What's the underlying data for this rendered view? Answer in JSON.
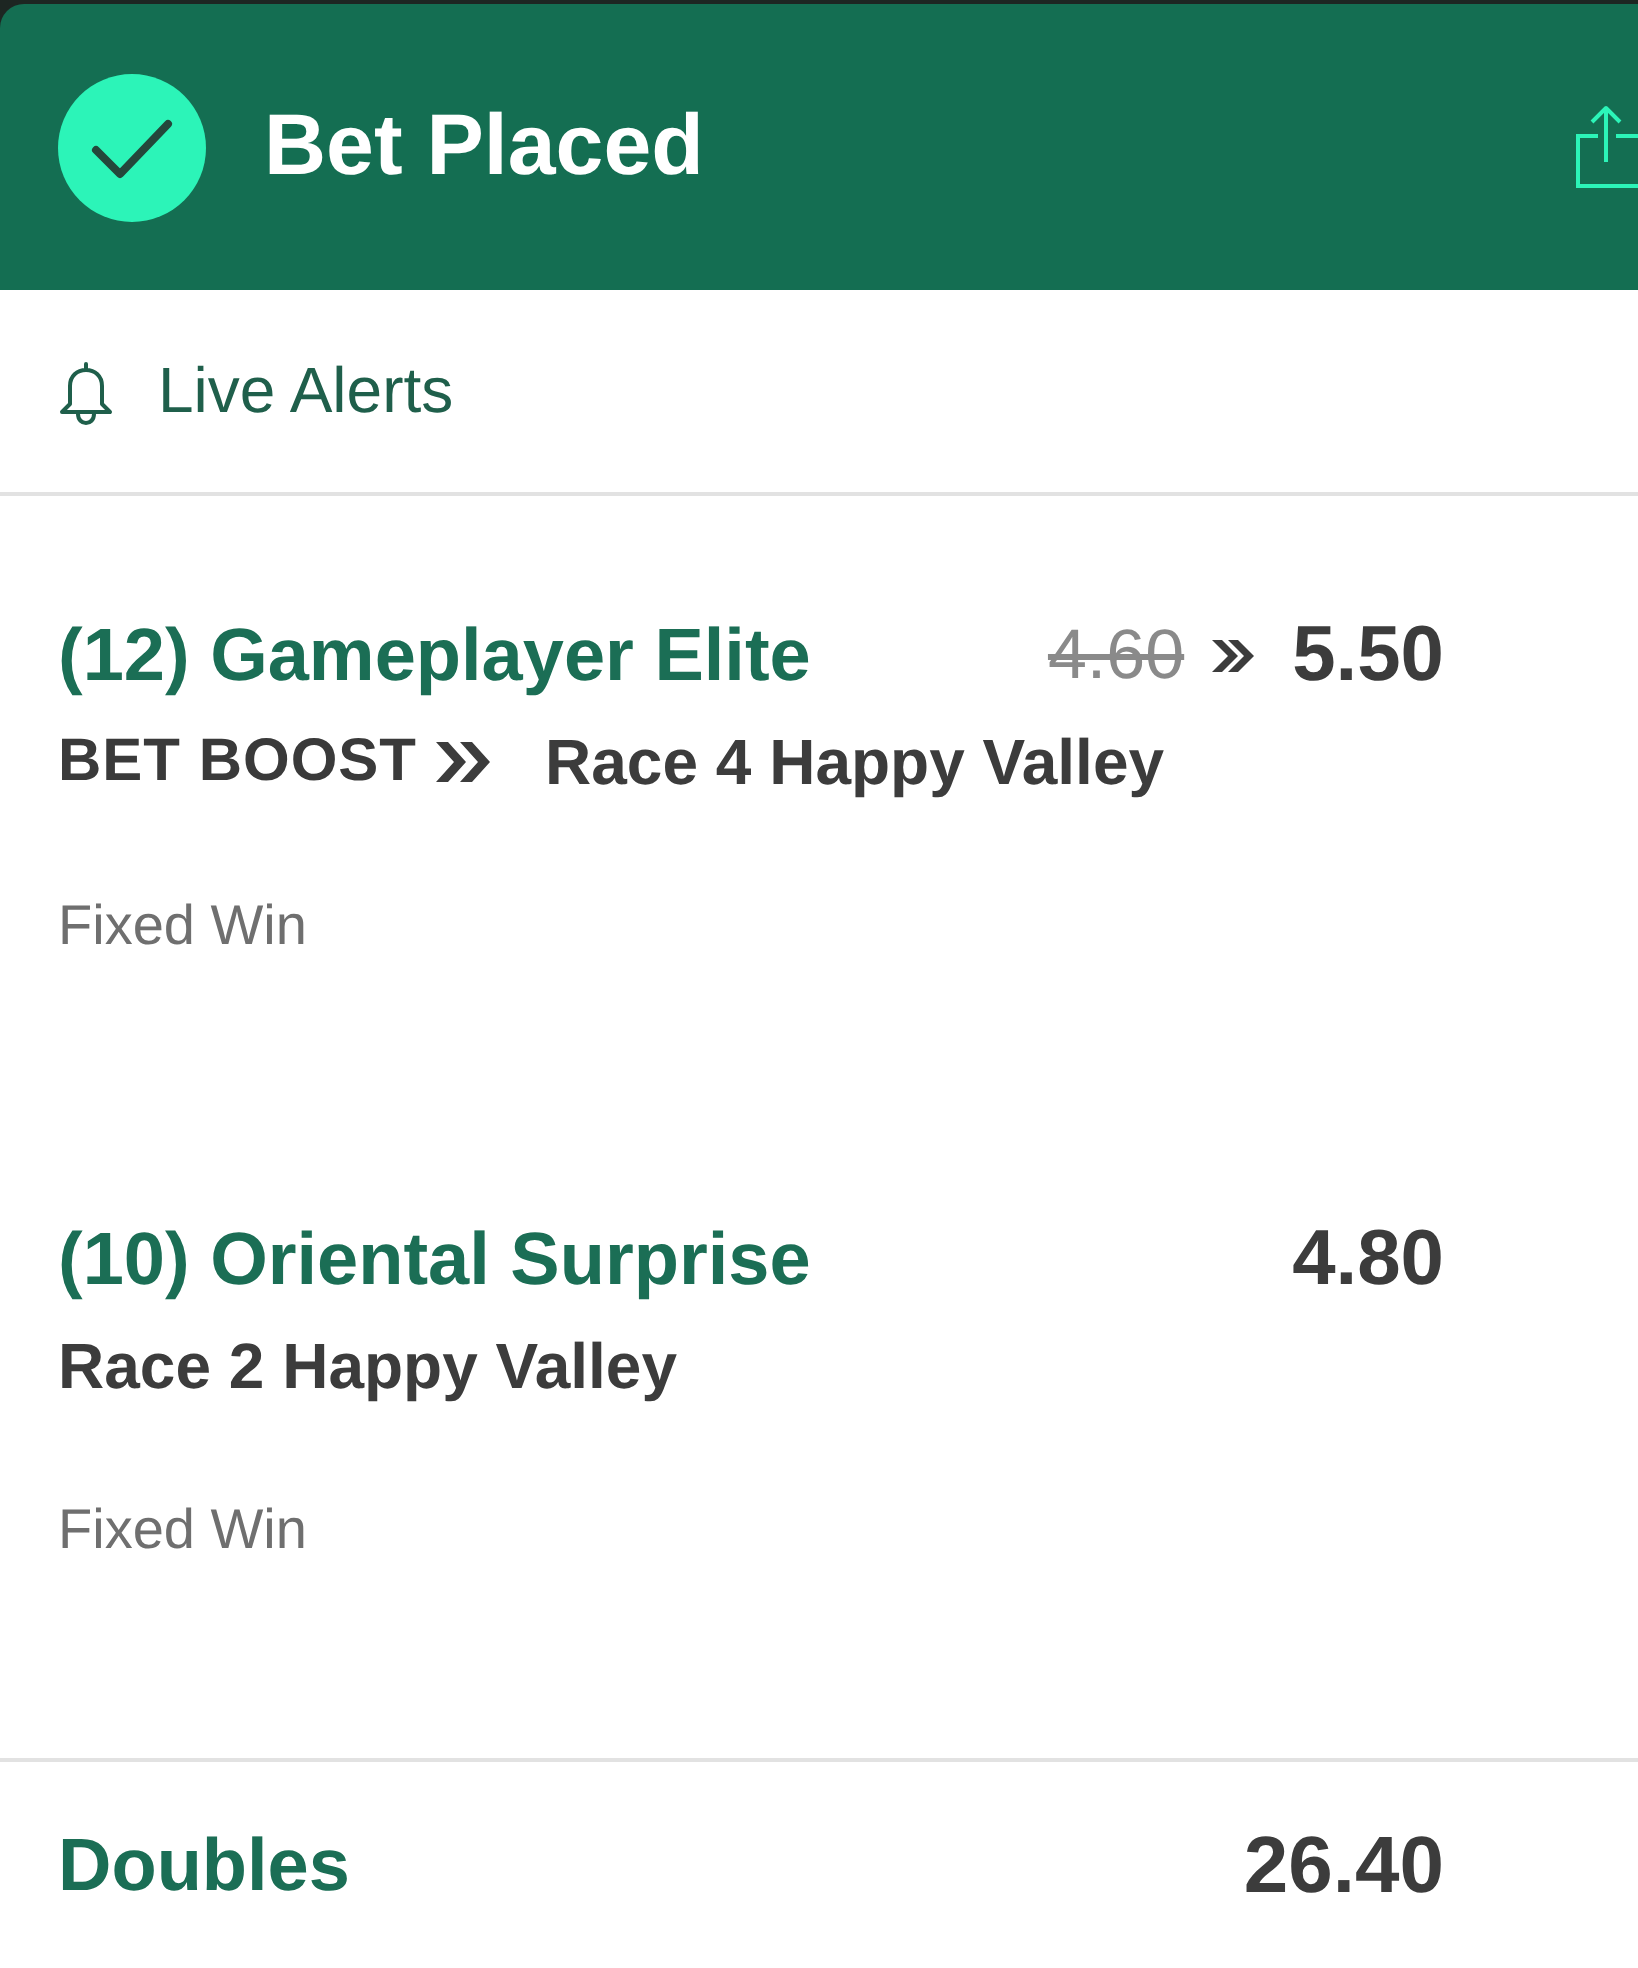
{
  "header": {
    "title": "Bet Placed"
  },
  "alerts": {
    "label": "Live Alerts"
  },
  "selections": [
    {
      "kind": "boosted",
      "name": "(12) Gameplayer Elite",
      "old_odds": "4.60",
      "odds": "5.50",
      "boost_label": "BET BOOST",
      "race": "Race 4 Happy Valley",
      "market": "Fixed Win"
    },
    {
      "kind": "standard",
      "name": "(10) Oriental Surprise",
      "odds": "4.80",
      "race": "Race 2 Happy Valley",
      "market": "Fixed Win"
    }
  ],
  "multiple": {
    "label": "Doubles",
    "odds": "26.40"
  }
}
